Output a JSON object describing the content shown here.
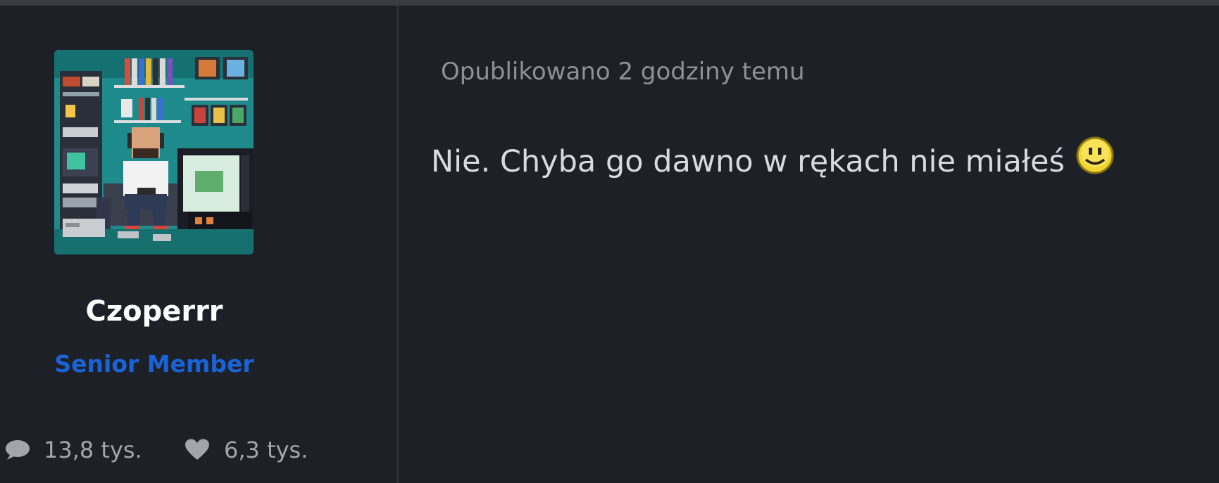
{
  "author": {
    "username": "Czoperrr",
    "rank": "Senior Member",
    "stats": {
      "posts_icon": "speech-bubble-icon",
      "posts_count": "13,8 tys.",
      "likes_icon": "heart-icon",
      "likes_count": "6,3 tys."
    }
  },
  "post": {
    "published": "Opublikowano 2 godziny temu",
    "content": "Nie. Chyba go dawno w rękach nie miałeś",
    "emoji": "smiley-face-icon"
  },
  "colors": {
    "background": "#1e2028",
    "rank": "#1a63d6",
    "username": "#ffffff",
    "meta": "#8e9097",
    "text": "#d8dadf"
  }
}
